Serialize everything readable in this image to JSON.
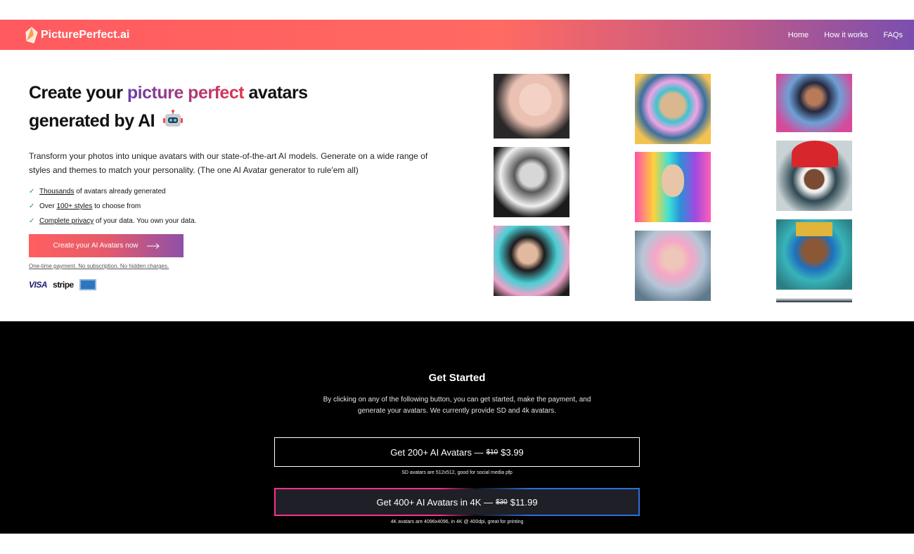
{
  "nav": {
    "logo_text": "PicturePerfect.ai",
    "links": [
      "Home",
      "How it works",
      "FAQs"
    ]
  },
  "hero": {
    "title_part1": "Create your ",
    "title_highlight": "picture perfect",
    "title_part2": " avatars",
    "title_line2": "generated by AI",
    "description": "Transform your photos into unique avatars with our state-of-the-art AI models. Generate on a wide range of styles and themes to match your personality. (The one AI Avatar generator to rule'em all)",
    "features": [
      {
        "link": "Thousands",
        "text": " of avatars already generated",
        "prefix": ""
      },
      {
        "prefix": "Over ",
        "link": "100+ styles",
        "text": " to choose from"
      },
      {
        "prefix": "",
        "link": "Complete privacy",
        "text": " of your data. You own your data."
      }
    ],
    "cta_label": "Create your AI Avatars now",
    "fine_print": "One-time payment. No subscription. No hidden charges.",
    "payment_logos": {
      "visa": "VISA",
      "stripe": "stripe"
    }
  },
  "get_started": {
    "title": "Get Started",
    "description": "By clicking on any of the following button, you can get started, make the payment, and generate your avatars. We currently provide SD and 4k avatars.",
    "sd": {
      "label": "Get 200+ AI Avatars —",
      "old_price": "$10",
      "price": "$3.99",
      "note": "SD avatars are 512x512, good for social media pfp"
    },
    "hd": {
      "label": "Get 400+ AI Avatars in 4K —",
      "old_price": "$30",
      "price": "$11.99",
      "note": "4K avatars are 4096x4096, in 4K @ 400dpi, great for printing"
    }
  },
  "colors": {
    "brand_start": "#ff5a5f",
    "brand_end": "#7a4fb0",
    "check": "#22a148"
  }
}
